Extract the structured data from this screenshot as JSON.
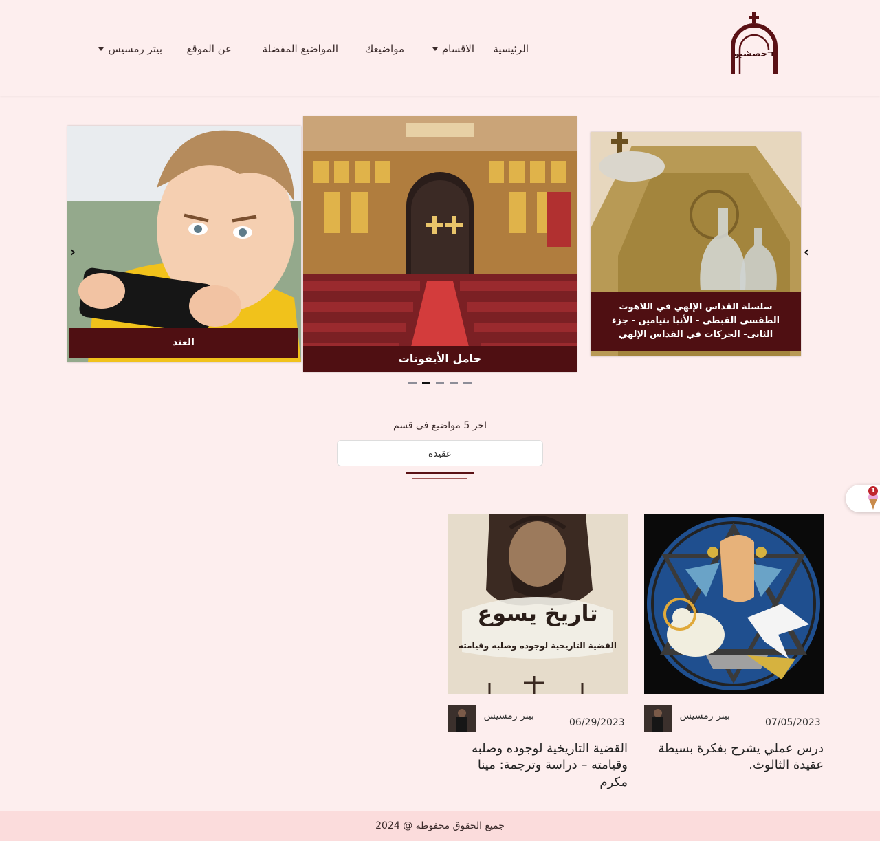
{
  "header": {
    "logo_text": "ﬢﺧﺻﺸﻴﻮ",
    "nav": [
      {
        "label": "الرئيسية",
        "dropdown": false
      },
      {
        "label": "الاقسام",
        "dropdown": true
      },
      {
        "label": "مواضيعك",
        "dropdown": false
      },
      {
        "label": "المواضيع المفضلة",
        "dropdown": false
      },
      {
        "label": "عن الموقع",
        "dropdown": false
      },
      {
        "label": "بيتر رمسيس",
        "dropdown": true
      }
    ]
  },
  "carousel": {
    "slides": [
      {
        "caption": "العند",
        "image": "boy-with-phone"
      },
      {
        "caption": "حامل الأيقونات",
        "image": "church-iconostasis"
      },
      {
        "caption": "سلسلة القداس الإلهي في اللاهوت الطقسي القبطي - الأنبا بنيامين - جزء الثانى- الحركات في القداس الإلهي",
        "image": "altar-vessels"
      }
    ],
    "dots_count": 5,
    "active_dot": 1,
    "prev_icon": "chevron-left-icon",
    "next_icon": "chevron-right-icon"
  },
  "section": {
    "title": "اخر 5 مواضيع فى قسم",
    "selected_category": "عقيدة"
  },
  "cards": [
    {
      "image": "trinity-stained-glass",
      "author": "بيتر رمسيس",
      "date": "07/05/2023",
      "title": "درس عملي يشرح بفكرة بسيطة عقيدة الثالوث."
    },
    {
      "image": "history-of-jesus",
      "image_text_main": "تاريخ يسوع",
      "image_text_sub": "القضية التاريخية لوجوده وصلبه وقيامته",
      "author": "بيتر رمسيس",
      "date": "06/29/2023",
      "title": "القضية التاريخية لوجوده وصلبه وقيامته – دراسة وترجمة: مينا مكرم"
    }
  ],
  "notification": {
    "count": "1",
    "icon": "ice-cream-icon"
  },
  "footer": {
    "text": "جميع الحقوق محفوظة @ 2024"
  },
  "colors": {
    "background": "#fdeeee",
    "accent": "#4f0f12",
    "footer": "#fbdcdc"
  }
}
